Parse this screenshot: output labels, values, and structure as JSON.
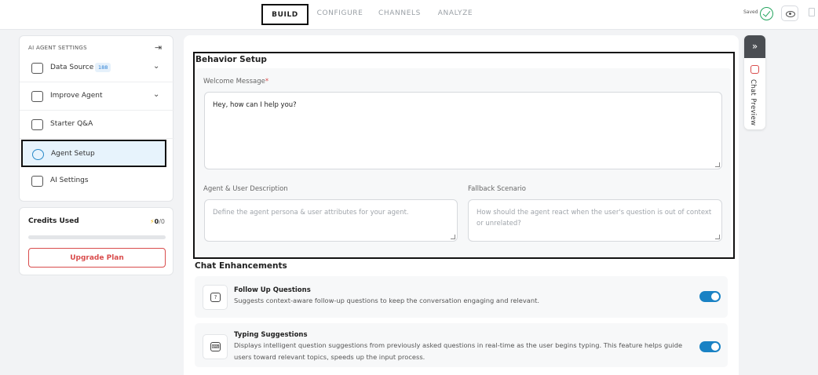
{
  "topbar": {
    "tabs": [
      {
        "label": "BUILD",
        "active": true
      },
      {
        "label": "CONFIGURE",
        "active": false
      },
      {
        "label": "CHANNELS",
        "active": false
      },
      {
        "label": "ANALYZE",
        "active": false
      }
    ],
    "saved_label": "Saved",
    "icons": [
      "check-circle-icon",
      "eye-icon",
      "document-icon"
    ]
  },
  "sidebar": {
    "title": "AI AGENT SETTINGS",
    "items": [
      {
        "label": "Data Source",
        "badge": "188",
        "icon": "cloud-upload-icon",
        "expandable": true
      },
      {
        "label": "Improve Agent",
        "icon": "robot-icon",
        "expandable": true
      },
      {
        "label": "Starter Q&A",
        "icon": "qa-icon",
        "expandable": false
      },
      {
        "label": "Agent Setup",
        "icon": "gear-icon",
        "expandable": false,
        "active": true
      },
      {
        "label": "AI Settings",
        "icon": "ai-settings-icon",
        "expandable": false
      }
    ]
  },
  "credits": {
    "title": "Credits Used",
    "used": "0",
    "total": "/0",
    "progress": 0,
    "upgrade_label": "Upgrade Plan"
  },
  "behavior": {
    "title": "Behavior Setup",
    "welcome_label": "Welcome Message",
    "welcome_required": "*",
    "welcome_value": "Hey, how can I help you?",
    "agent_desc_label": "Agent & User Description",
    "agent_desc_placeholder": "Define the agent persona & user attributes for your agent.",
    "fallback_label": "Fallback Scenario",
    "fallback_placeholder": "How should the agent react when the user's question is out of context or unrelated?"
  },
  "enhancements": {
    "title": "Chat Enhancements",
    "items": [
      {
        "title": "Follow Up Questions",
        "desc": "Suggests context-aware follow-up questions to keep the conversation engaging and relevant.",
        "enabled": true,
        "icon": "question-bubble-icon"
      },
      {
        "title": "Typing Suggestions",
        "desc": "Displays intelligent question suggestions from previously asked questions in real-time as the user begins typing. This feature helps guide users toward relevant topics, speeds up the input process.",
        "enabled": true,
        "icon": "keyboard-suggestion-icon"
      }
    ]
  },
  "chat_preview": {
    "label": "Chat Preview"
  },
  "colors": {
    "accent": "#1a82c4",
    "danger": "#d94c4c",
    "success": "#25a55f"
  }
}
